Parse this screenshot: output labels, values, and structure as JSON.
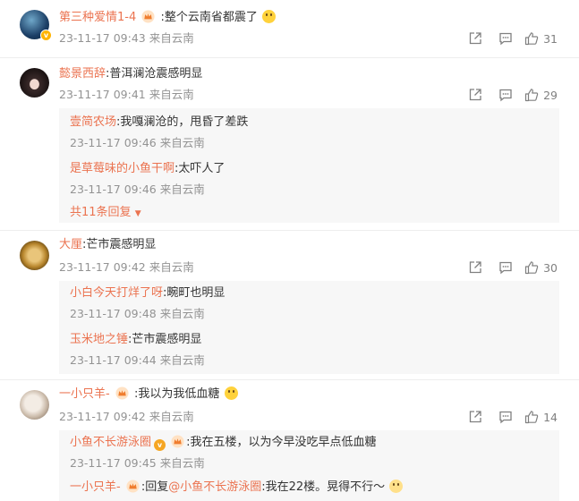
{
  "comments": [
    {
      "user": "第三种爱情1-4",
      "text": ":整个云南省都震了",
      "time": "23-11-17 09:43 来自云南",
      "likes": "31",
      "has_vip_crown": true,
      "emoji": "laughing-emoji"
    },
    {
      "user": "懿景西辞",
      "text": ":普洱澜沧震感明显",
      "time": "23-11-17 09:41 来自云南",
      "likes": "29",
      "replies": [
        {
          "user": "壹简农场",
          "text": ":我嘎澜沧的，甩昏了差跌",
          "time": "23-11-17 09:46 来自云南"
        },
        {
          "user": "是草莓味的小鱼干啊",
          "text": ":太吓人了",
          "time": "23-11-17 09:46 来自云南"
        }
      ],
      "more_replies": "共11条回复"
    },
    {
      "user": "大厘",
      "text": ":芒市震感明显",
      "time": "23-11-17 09:42 来自云南",
      "likes": "30",
      "replies": [
        {
          "user": "小白今天打烊了呀",
          "text": ":畹町也明显",
          "time": "23-11-17 09:48 来自云南"
        },
        {
          "user": "玉米地之锤",
          "text": ":芒市震感明显",
          "time": "23-11-17 09:44 来自云南"
        }
      ]
    },
    {
      "user": "一小只羊-",
      "text": ":我以为我低血糖",
      "time": "23-11-17 09:42 来自云南",
      "likes": "14",
      "has_vip_crown": true,
      "emoji": "crying-emoji",
      "replies": [
        {
          "user": "小鱼不长游泳圈",
          "text": ":我在五楼，以为今早没吃早点低血糖",
          "time": "23-11-17 09:45 来自云南"
        },
        {
          "user": "一小只羊-",
          "text_prefix": ":回复",
          "mention": "@小鱼不长游泳圈",
          "text": ":我在22楼。晃得不行～"
        }
      ]
    }
  ],
  "icons": [
    "share-icon",
    "comment-icon",
    "like-icon"
  ],
  "colors": {
    "username": "#eb7350",
    "meta": "#939393",
    "reply_bg": "#f7f7f7"
  }
}
